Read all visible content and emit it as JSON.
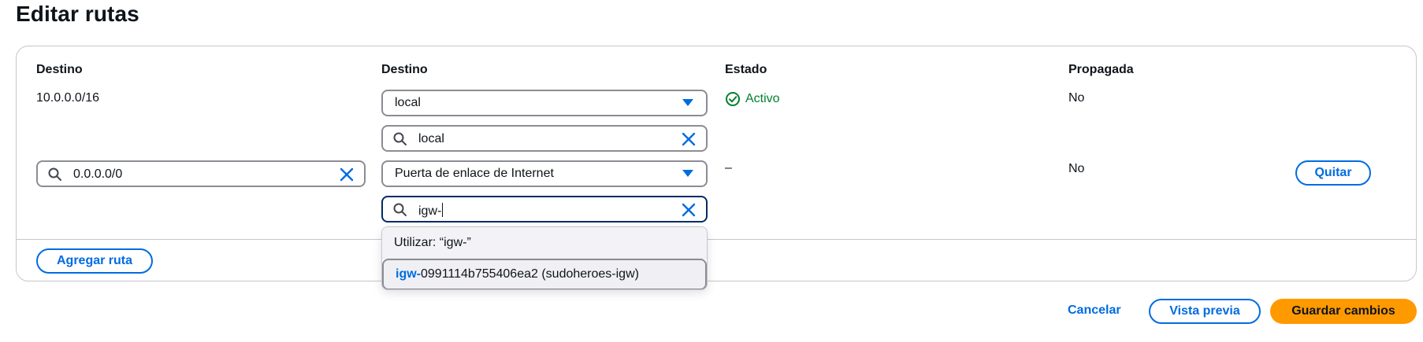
{
  "page": {
    "title": "Editar rutas"
  },
  "columns": {
    "destino": "Destino",
    "target": "Destino",
    "estado": "Estado",
    "propagada": "Propagada"
  },
  "rows": [
    {
      "destination": "10.0.0.0/16",
      "target_type": "local",
      "target_search": "local",
      "status": "Activo",
      "propagated": "No"
    },
    {
      "destination": "0.0.0.0/0",
      "target_type": "Puerta de enlace de Internet",
      "target_search": "igw-",
      "status": "–",
      "propagated": "No",
      "remove_label": "Quitar"
    }
  ],
  "dropdown": {
    "use_label": "Utilizar: “igw-”",
    "option_match": "igw-",
    "option_rest": "0991114b755406ea2 (sudoheroes-igw)"
  },
  "actions": {
    "add_route": "Agregar ruta",
    "cancel": "Cancelar",
    "preview": "Vista previa",
    "save": "Guardar cambios"
  },
  "colors": {
    "accent": "#006ce0",
    "success": "#00802f",
    "primary_button": "#ff9900"
  }
}
